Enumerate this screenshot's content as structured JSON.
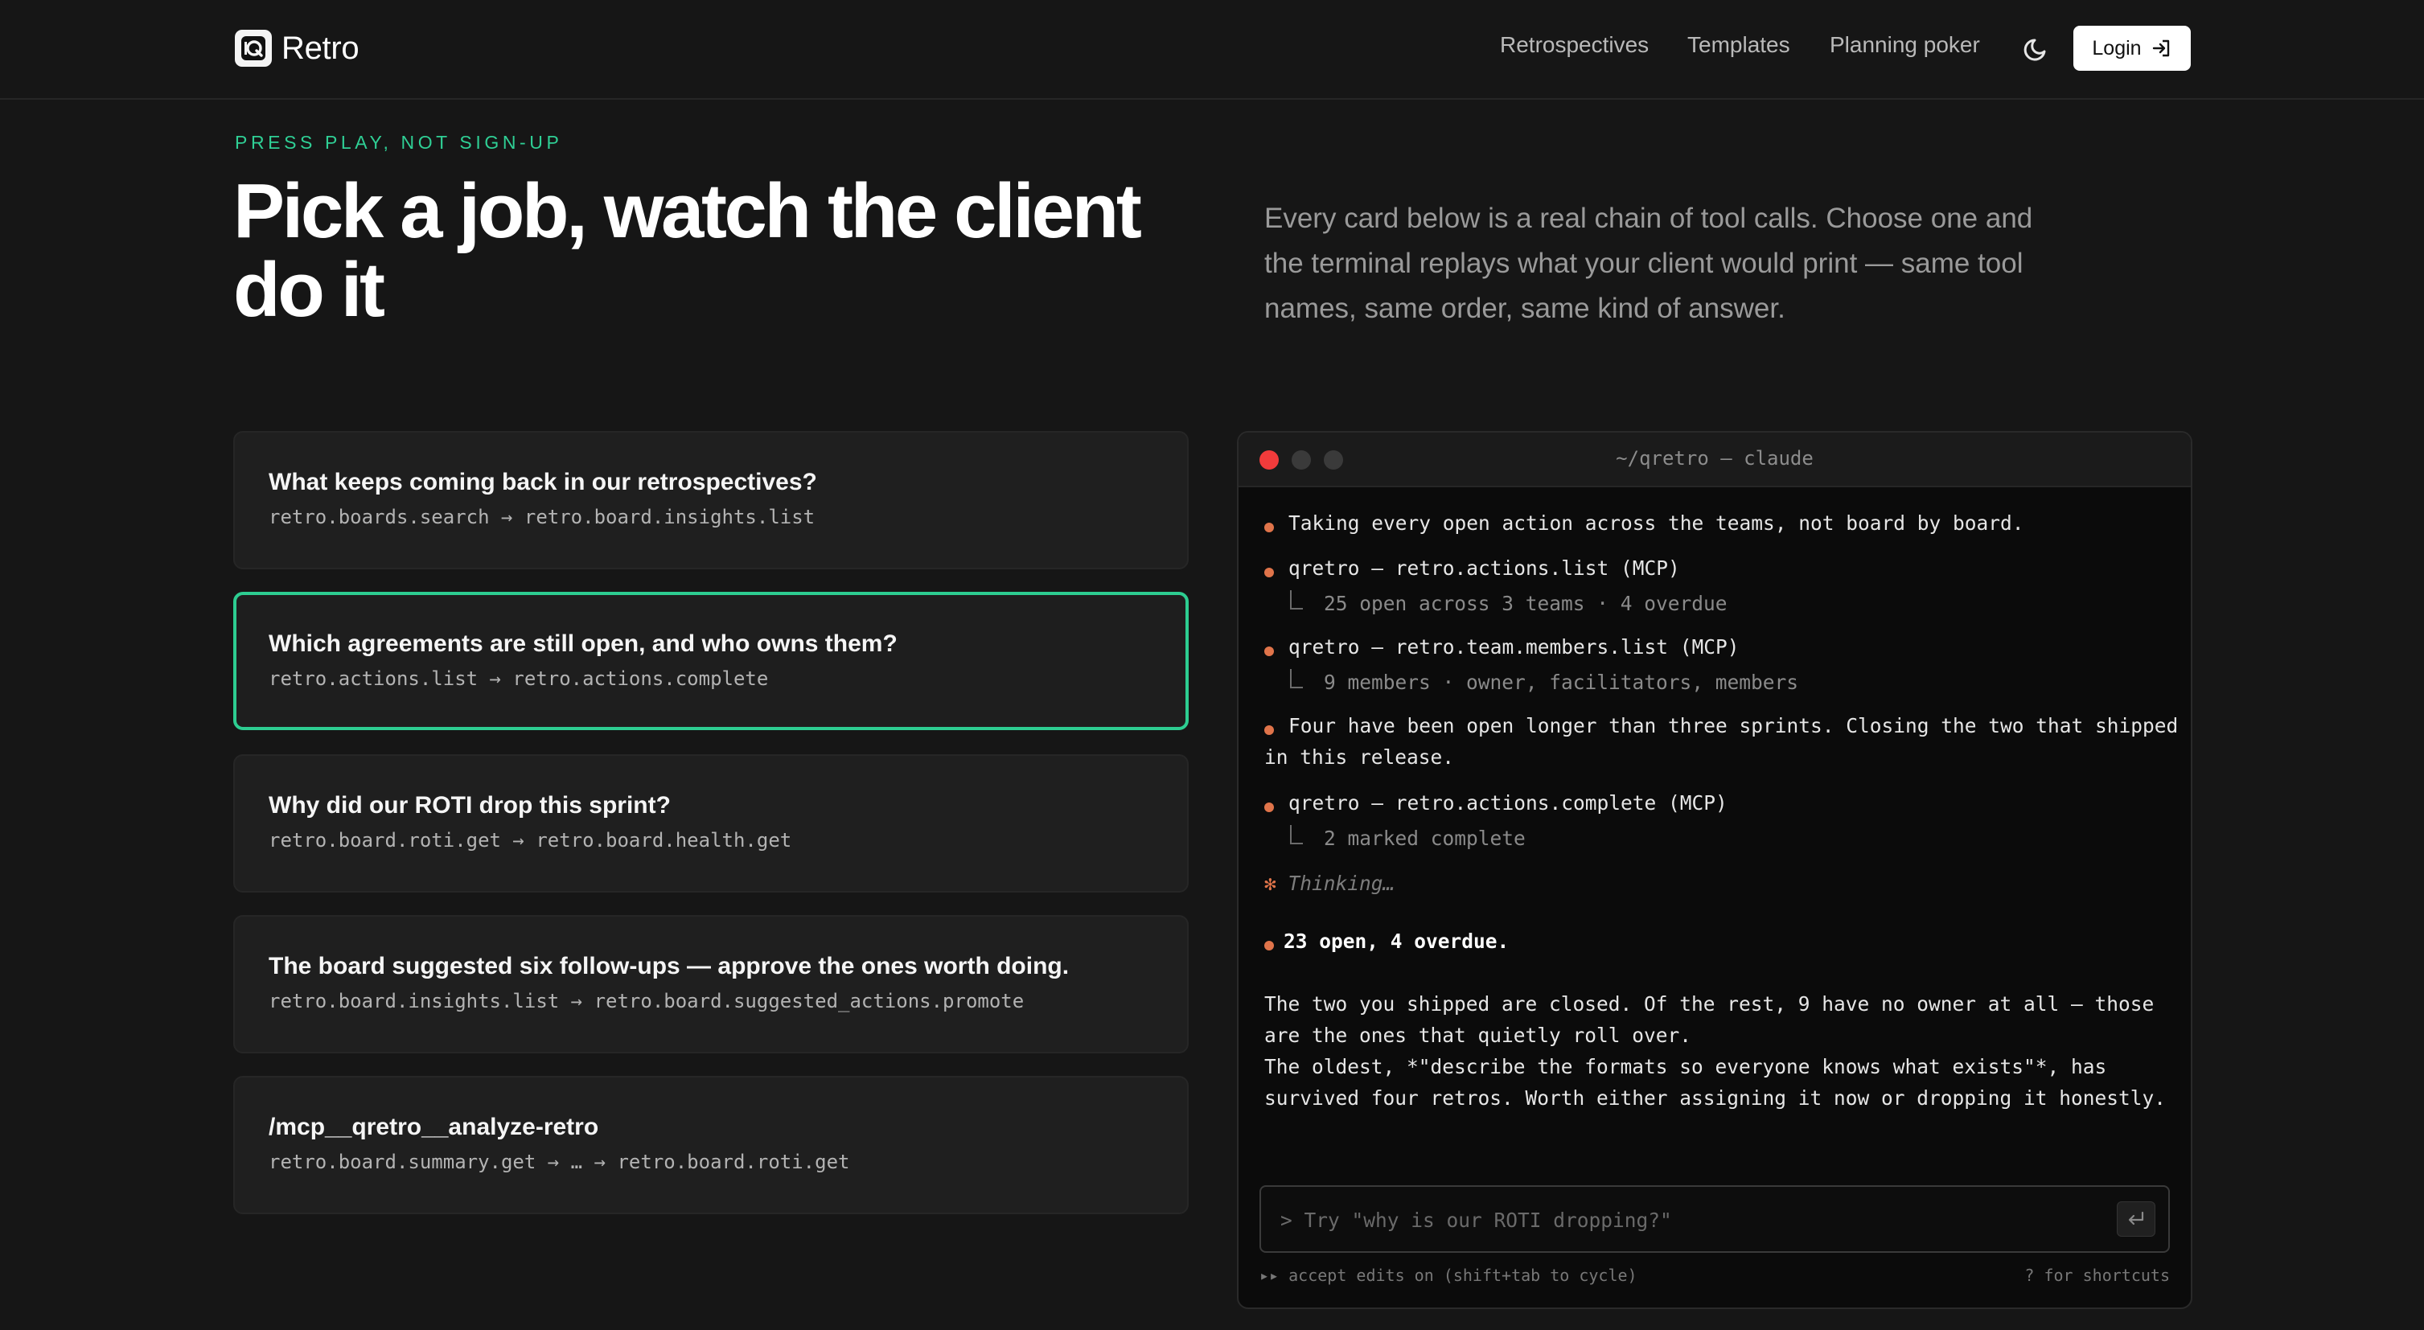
{
  "header": {
    "logo_text": "Retro",
    "nav": [
      "Retrospectives",
      "Templates",
      "Planning poker"
    ],
    "login_label": "Login"
  },
  "hero": {
    "kicker": "PRESS PLAY, NOT SIGN-UP",
    "title": "Pick a job, watch the client do it",
    "description": "Every card below is a real chain of tool calls. Choose one and the terminal replays what your client would print — same tool names, same order, same kind of answer."
  },
  "cards": [
    {
      "title": "What keeps coming back in our retrospectives?",
      "chain": "retro.boards.search → retro.board.insights.list",
      "active": false
    },
    {
      "title": "Which agreements are still open, and who owns them?",
      "chain": "retro.actions.list → retro.actions.complete",
      "active": true
    },
    {
      "title": "Why did our ROTI drop this sprint?",
      "chain": "retro.board.roti.get → retro.board.health.get",
      "active": false
    },
    {
      "title": "The board suggested six follow-ups — approve the ones worth doing.",
      "chain": "retro.board.insights.list → retro.board.suggested_actions.promote",
      "active": false
    },
    {
      "title": "/mcp__qretro__analyze-retro",
      "chain": "retro.board.summary.get → … → retro.board.roti.get",
      "active": false
    }
  ],
  "terminal": {
    "title": "~/qretro — claude",
    "lines": {
      "l1": "Taking every open action across the teams, not board by board.",
      "l2": "qretro – retro.actions.list (MCP)",
      "l2s": "25 open across 3 teams · 4 overdue",
      "l3": "qretro – retro.team.members.list (MCP)",
      "l3s": "9 members · owner, facilitators, members",
      "l4a": "Four have been open longer than three sprints. Closing the two that shipped",
      "l4b": "in this release.",
      "l5": "qretro – retro.actions.complete (MCP)",
      "l5s": "2 marked complete",
      "thinking": "Thinking…",
      "summary": "23 open, 4 overdue.",
      "p1a": "The two you shipped are closed. Of the rest, 9 have no owner at all — those",
      "p1b": "are the ones that quietly roll over.",
      "p2a": "The oldest, *\"describe the formats so everyone knows what exists\"*, has",
      "p2b": "survived four retros. Worth either assigning it now or dropping it honestly."
    },
    "input_placeholder": "> Try \"why is our ROTI dropping?\"",
    "footer_left": "▸▸ accept edits on (shift+tab to cycle)",
    "footer_right": "? for shortcuts"
  },
  "colors": {
    "accent": "#2dcd91",
    "bullet": "#e0744a",
    "traffic_red": "#f23b3b",
    "traffic_gray": "#3a3a3a"
  }
}
